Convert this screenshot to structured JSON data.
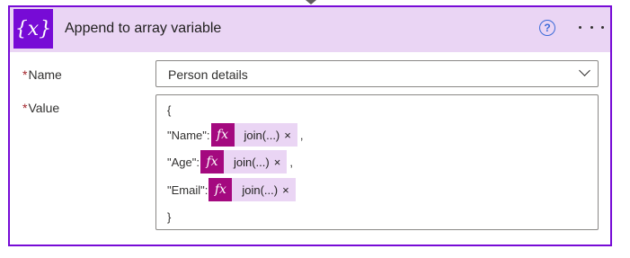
{
  "action": {
    "icon_text": "{x}",
    "title": "Append to array variable",
    "help_glyph": "?"
  },
  "fields": {
    "name": {
      "label": "Name",
      "required_mark": "*",
      "value": "Person details"
    },
    "value": {
      "label": "Value",
      "required_mark": "*"
    }
  },
  "value_content": {
    "open_brace": "{",
    "close_brace": "}",
    "lines": [
      {
        "key": "\"Name\":",
        "token_icon": "fx",
        "token_text": "join(...)",
        "remove": "×",
        "suffix": ","
      },
      {
        "key": "\"Age\":",
        "token_icon": "fx",
        "token_text": "join(...)",
        "remove": "×",
        "suffix": ","
      },
      {
        "key": "\"Email\":",
        "token_icon": "fx",
        "token_text": "join(...)",
        "remove": "×",
        "suffix": ""
      }
    ]
  },
  "colors": {
    "accent": "#770bd6",
    "header_bg": "#ead5f4",
    "expression_token": "#a4097f",
    "required": "#a4262c"
  }
}
